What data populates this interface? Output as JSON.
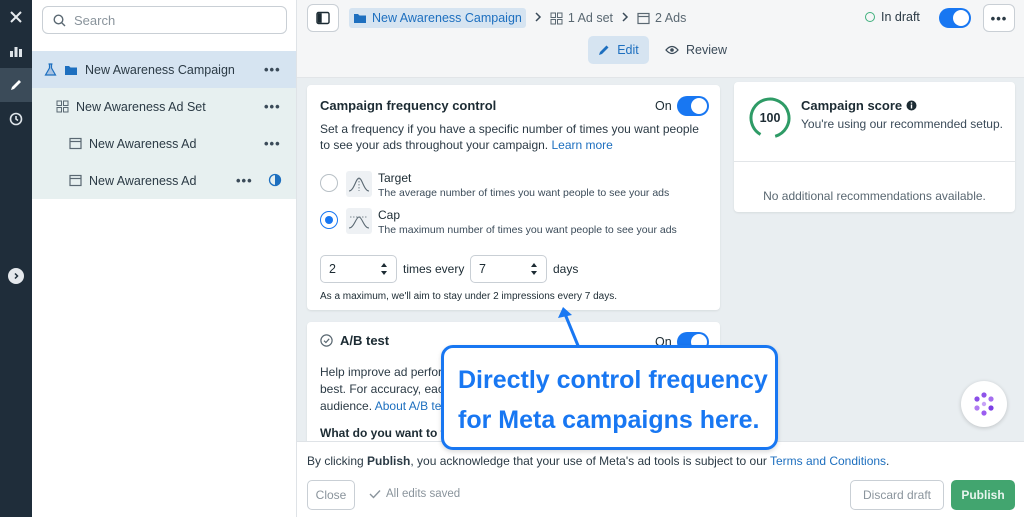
{
  "search": {
    "placeholder": "Search"
  },
  "tree": {
    "campaign": "New Awareness Campaign",
    "adset": "New Awareness Ad Set",
    "ads": [
      "New Awareness Ad",
      "New Awareness Ad"
    ],
    "more_label": "•••"
  },
  "breadcrumb": {
    "campaign": "New Awareness Campaign",
    "adset": "1 Ad set",
    "ads": "2 Ads"
  },
  "status": {
    "label": "In draft",
    "more_label": "•••"
  },
  "modes": {
    "edit": "Edit",
    "review": "Review"
  },
  "frequency_control": {
    "title": "Campaign frequency control",
    "toggle_label": "On",
    "description": "Set a frequency if you have a specific number of times you want people to see your ads throughout your campaign.",
    "learn_more": "Learn more",
    "options": [
      {
        "label": "Target",
        "description": "The average number of times you want people to see your ads",
        "selected": false
      },
      {
        "label": "Cap",
        "description": "The maximum number of times you want people to see your ads",
        "selected": true
      }
    ],
    "times_value": "2",
    "times_label": "times every",
    "days_value": "7",
    "days_label": "days",
    "note": "As a maximum, we'll aim to stay under 2 impressions every 7 days."
  },
  "campaign_score": {
    "score": "100",
    "title": "Campaign score",
    "subtitle": "You're using our recommended setup.",
    "empty": "No additional recommendations available."
  },
  "ab_test": {
    "title": "A/B test",
    "toggle_label": "On",
    "description_lines": [
      "Help improve ad perfor",
      "best. For accuracy, each",
      "audience."
    ],
    "about_link": "About A/B tes",
    "question": "What do you want to te"
  },
  "footer": {
    "terms_prefix": "By clicking ",
    "terms_bold": "Publish",
    "terms_middle": ", you acknowledge that your use of Meta's ad tools is subject to our ",
    "terms_link": "Terms and Conditions",
    "terms_suffix": ".",
    "close": "Close",
    "saved": "All edits saved",
    "discard": "Discard draft",
    "publish": "Publish"
  },
  "callout": {
    "line1": "Directly control frequency",
    "line2": "for Meta campaigns here."
  },
  "colors": {
    "accent": "#1877f2",
    "success": "#42a56f",
    "selection": "#d6e4f1"
  }
}
